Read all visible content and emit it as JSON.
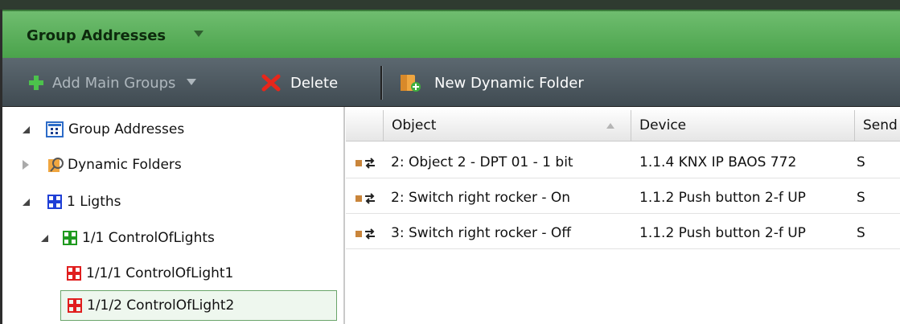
{
  "panel": {
    "title": "Group Addresses"
  },
  "toolbar": {
    "add_main_groups": "Add Main Groups",
    "delete": "Delete",
    "new_dynamic_folder": "New Dynamic Folder"
  },
  "tree": {
    "items": [
      {
        "label": "Group Addresses",
        "icon": "group-addresses-icon",
        "expanded": true
      },
      {
        "label": "Dynamic Folders",
        "icon": "dynamic-folder-icon",
        "expanded": false
      },
      {
        "label": "1 Ligths",
        "icon": "main-group-icon",
        "expanded": true
      },
      {
        "label": "1/1 ControlOfLights",
        "icon": "middle-group-icon",
        "expanded": true
      },
      {
        "label": "1/1/1 ControlOfLight1",
        "icon": "group-address-icon"
      },
      {
        "label": "1/1/2 ControlOfLight2",
        "icon": "group-address-icon",
        "selected": true
      }
    ]
  },
  "table": {
    "columns": [
      "Object",
      "Device",
      "Send"
    ],
    "sort_column": "Object",
    "rows": [
      {
        "object": "2: Object 2 - DPT 01 - 1 bit",
        "device": "1.1.4  KNX IP BAOS 772",
        "send": "S"
      },
      {
        "object": "2: Switch right rocker - On",
        "device": "1.1.2  Push button 2-f UP",
        "send": "S"
      },
      {
        "object": "3: Switch right rocker - Off",
        "device": "1.1.2  Push button 2-f UP",
        "send": "S"
      }
    ]
  },
  "colors": {
    "title_bar": "#5aae5a",
    "toolbar": "#4a555c",
    "selection_border": "#6aa56a",
    "main_group_icon": "#1f3fd6",
    "middle_group_icon": "#1f9a1f",
    "group_address_icon": "#e01e1e"
  }
}
